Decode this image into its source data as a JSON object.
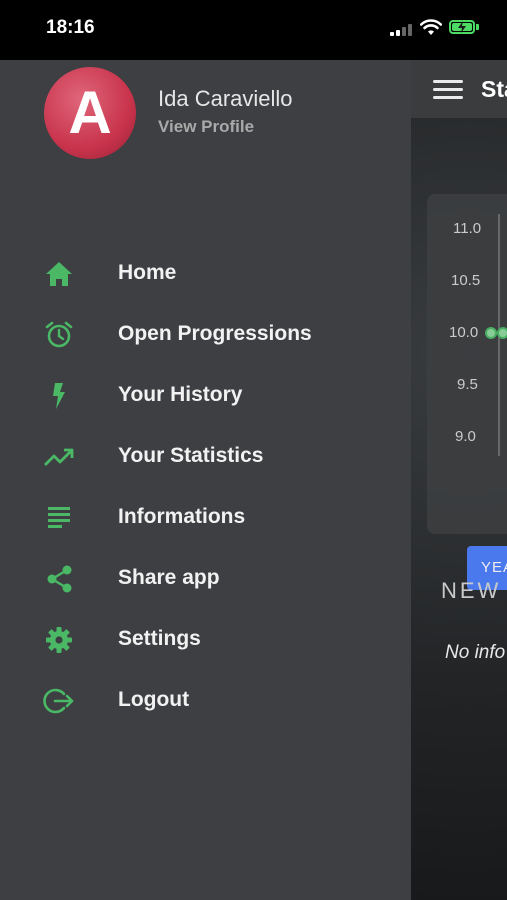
{
  "status_bar": {
    "time": "18:16"
  },
  "profile": {
    "avatar_letter": "A",
    "name": "Ida Caraviello",
    "view_profile_label": "View Profile"
  },
  "menu": {
    "items": [
      {
        "label": "Home",
        "icon": "home-icon"
      },
      {
        "label": "Open Progressions",
        "icon": "alarm-clock-icon"
      },
      {
        "label": "Your History",
        "icon": "lightning-icon"
      },
      {
        "label": "Your Statistics",
        "icon": "trending-up-icon"
      },
      {
        "label": "Informations",
        "icon": "text-lines-icon"
      },
      {
        "label": "Share app",
        "icon": "share-icon"
      },
      {
        "label": "Settings",
        "icon": "gear-icon"
      },
      {
        "label": "Logout",
        "icon": "logout-icon"
      }
    ]
  },
  "main": {
    "title": "Sta",
    "chart": {
      "ticks": [
        "11.0",
        "10.5",
        "10.0",
        "9.5",
        "9.0"
      ]
    },
    "year_button": "YEAR",
    "news_title": "NEW",
    "no_info": "No info"
  },
  "colors": {
    "accent": "#4ab865",
    "drawer_bg": "#3d3f42",
    "button_blue": "#4d80ff"
  }
}
